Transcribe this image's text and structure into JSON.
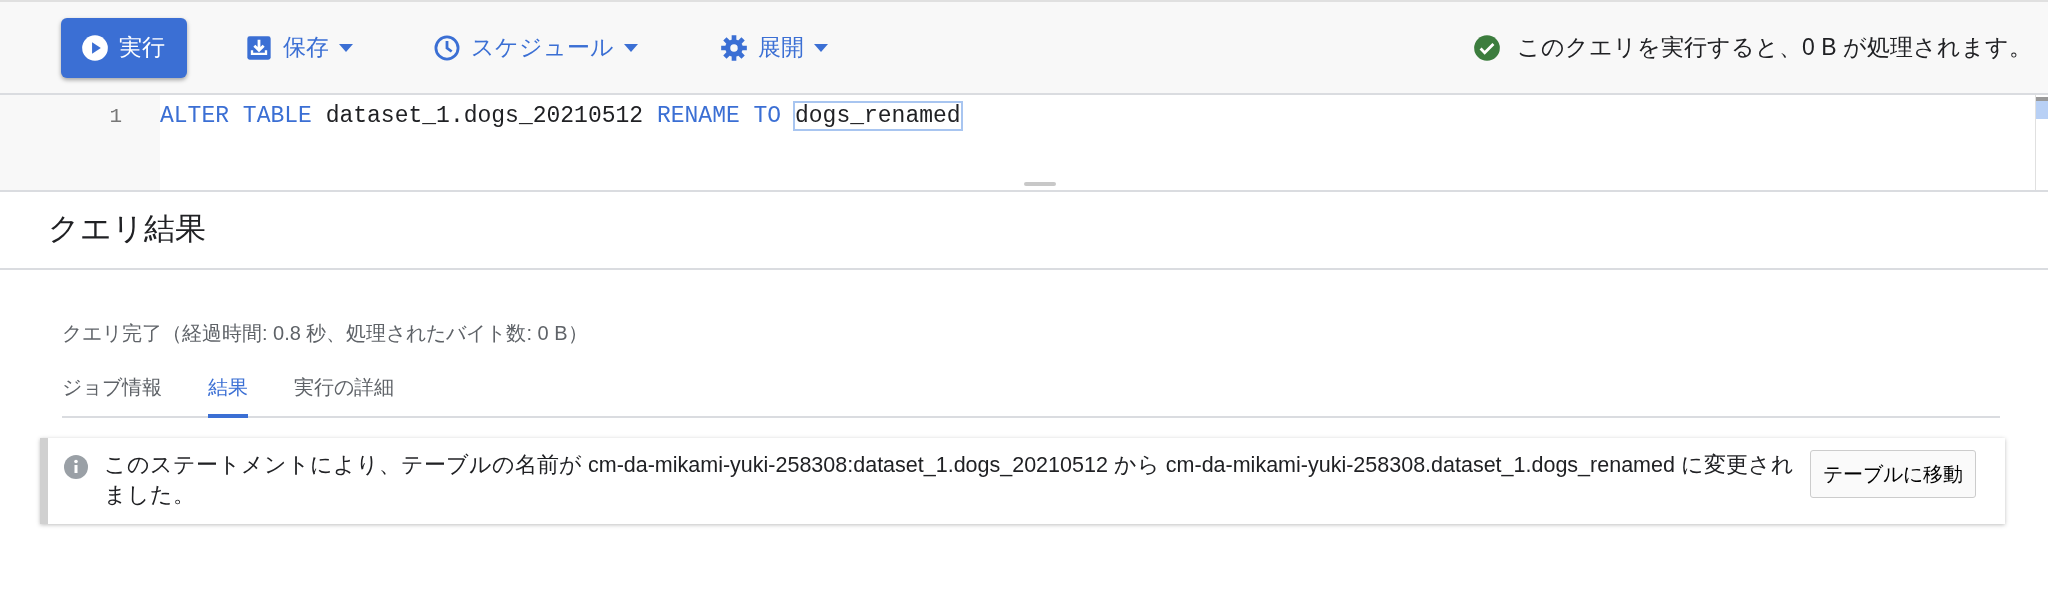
{
  "toolbar": {
    "run_button": "実行",
    "menus": [
      {
        "kind": "save",
        "label": "保存"
      },
      {
        "kind": "schedule",
        "label": "スケジュール"
      },
      {
        "kind": "deploy",
        "label": "展開"
      }
    ],
    "validation": {
      "valid": true,
      "text": "このクエリを実行すると、0 B が処理されます。"
    }
  },
  "editor": {
    "lines": [
      {
        "number": "1",
        "tokens": [
          {
            "text": "ALTER",
            "kind": "keyword",
            "highlighted": false
          },
          {
            "text": "TABLE",
            "kind": "keyword",
            "highlighted": false
          },
          {
            "text": "dataset_1.dogs_20210512",
            "kind": "identifier",
            "highlighted": false
          },
          {
            "text": "RENAME",
            "kind": "keyword",
            "highlighted": false
          },
          {
            "text": "TO",
            "kind": "keyword",
            "highlighted": false
          },
          {
            "text": "dogs_renamed",
            "kind": "identifier",
            "highlighted": true
          }
        ]
      }
    ]
  },
  "results": {
    "title": "クエリ結果",
    "status": "クエリ完了（経過時間: 0.8 秒、処理されたバイト数: 0 B）",
    "tabs": [
      {
        "label": "ジョブ情報",
        "selected": false
      },
      {
        "label": "結果",
        "selected": true
      },
      {
        "label": "実行の詳細",
        "selected": false
      }
    ],
    "message": {
      "text": "このステートメントにより、テーブルの名前が cm-da-mikami-yuki-258308:dataset_1.dogs_20210512 から cm-da-mikami-yuki-258308.dataset_1.dogs_renamed に変更されました。",
      "button": "テーブルに移動"
    }
  }
}
